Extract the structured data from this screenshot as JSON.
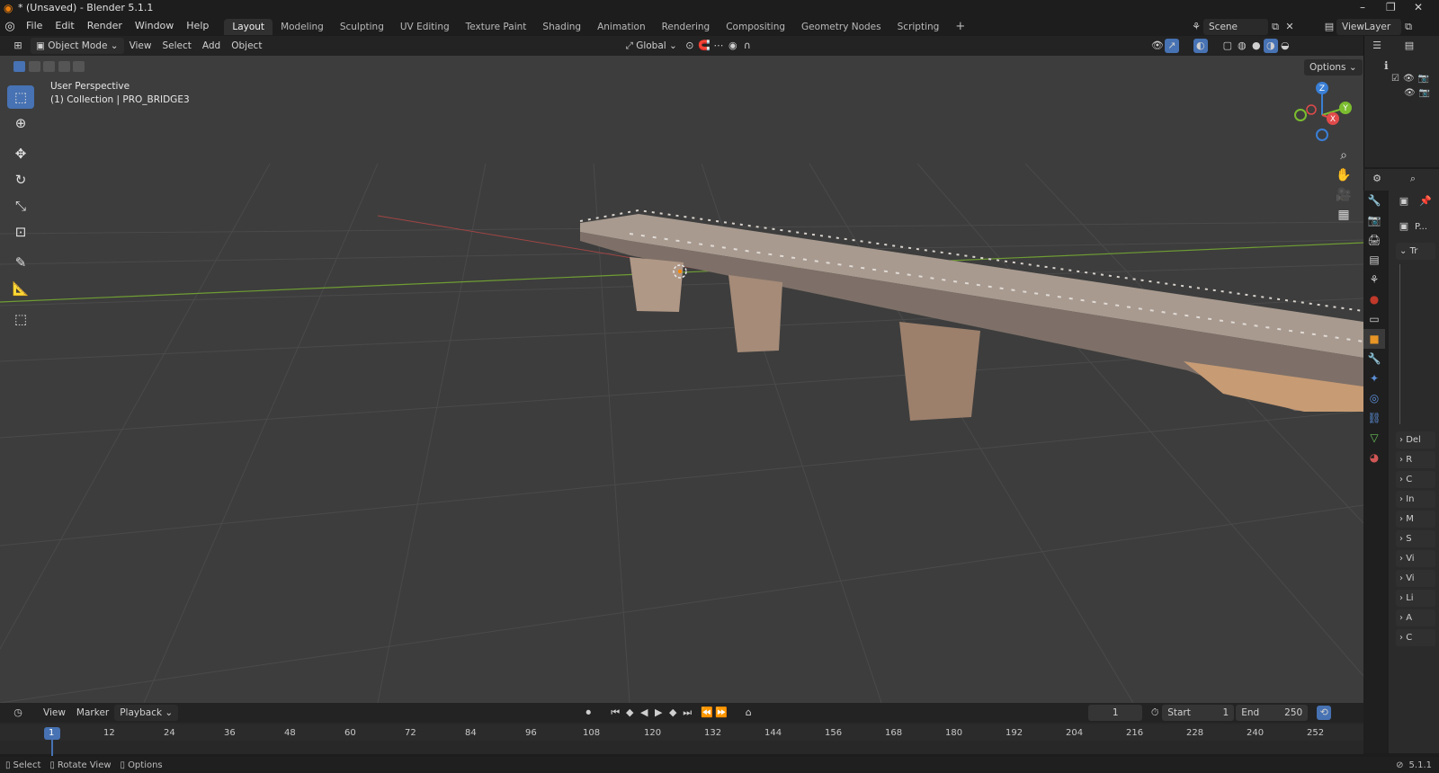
{
  "window": {
    "title": "* (Unsaved) - Blender 5.1.1",
    "buttons": [
      "–",
      "❐",
      "✕"
    ]
  },
  "menu": [
    "File",
    "Edit",
    "Render",
    "Window",
    "Help"
  ],
  "workspaces": [
    "Layout",
    "Modeling",
    "Sculpting",
    "UV Editing",
    "Texture Paint",
    "Shading",
    "Animation",
    "Rendering",
    "Compositing",
    "Geometry Nodes",
    "Scripting"
  ],
  "active_workspace": "Layout",
  "scene": {
    "scene_name": "Scene",
    "view_layer": "ViewLayer"
  },
  "viewport_header": {
    "mode": "Object Mode",
    "menus": [
      "View",
      "Select",
      "Add",
      "Object"
    ],
    "orientation": "Global",
    "options_label": "Options"
  },
  "viewport_overlay": {
    "perspective": "User Perspective",
    "collection": "(1) Collection | PRO_BRIDGE3"
  },
  "gizmo": {
    "z": "Z",
    "y": "Y",
    "x": "X"
  },
  "properties_sections": [
    "Tr",
    "Del",
    "R",
    "C",
    "In",
    "M",
    "S",
    "Vi",
    "Vi",
    "Li",
    "A",
    "C"
  ],
  "properties_header": "P...",
  "timeline": {
    "menus": [
      "View",
      "Marker",
      "Playback"
    ],
    "current_frame": "1",
    "start_label": "Start",
    "start": "1",
    "end_label": "End",
    "end": "250",
    "ruler": [
      "1",
      "12",
      "24",
      "36",
      "48",
      "60",
      "72",
      "84",
      "96",
      "108",
      "120",
      "132",
      "144",
      "156",
      "168",
      "180",
      "192",
      "204",
      "216",
      "228",
      "240",
      "252"
    ]
  },
  "statusbar": {
    "items": [
      "Select",
      "Rotate View",
      "Options"
    ],
    "version": "5.1.1"
  },
  "colors": {
    "accent": "#4772b3",
    "x_axis": "#e04a4a",
    "y_axis": "#7bbd2f",
    "z_axis": "#3a7fd6"
  }
}
